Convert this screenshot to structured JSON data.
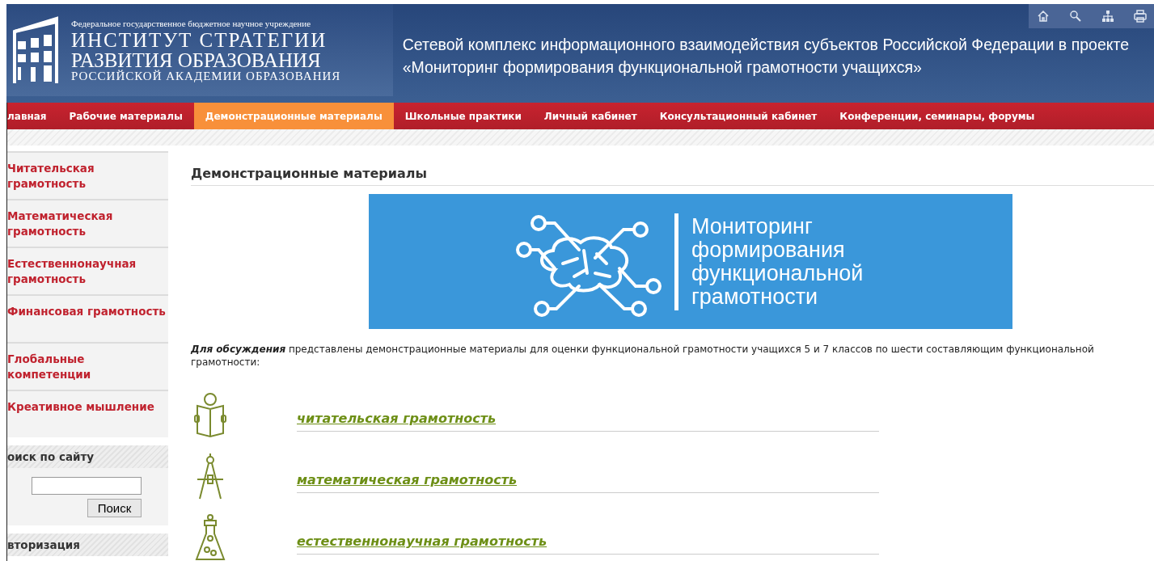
{
  "header": {
    "org_line": "Федеральное государственное бюджетное научное учреждение",
    "logo_lines": [
      "ИНСТИТУТ СТРАТЕГИИ",
      "РАЗВИТИЯ ОБРАЗОВАНИЯ",
      "РОССИЙСКОЙ АКАДЕМИИ ОБРАЗОВАНИЯ"
    ],
    "site_title": "Сетевой комплекс информационного взаимодействия субъектов Российской Федерации в проекте «Мониторинг формирования функциональной грамотности учащихся»"
  },
  "nav": [
    {
      "label": "лавная",
      "selected": false
    },
    {
      "label": "Рабочие материалы",
      "selected": false
    },
    {
      "label": "Демонстрационные материалы",
      "selected": true
    },
    {
      "label": "Школьные практики",
      "selected": false
    },
    {
      "label": "Личный кабинет",
      "selected": false
    },
    {
      "label": "Консультационный кабинет",
      "selected": false
    },
    {
      "label": "Конференции, семинары, форумы",
      "selected": false
    }
  ],
  "sidebar": {
    "items": [
      "Читательская грамотность",
      "Математическая грамотность",
      "Естественнонаучная грамотность",
      "Финансовая грамотность",
      "Глобальные компетенции",
      "Креативное мышление"
    ],
    "search": {
      "title": "оиск по сайту",
      "button": "Поиск"
    },
    "auth_title": "вторизация"
  },
  "content": {
    "heading": "Демонстрационные материалы",
    "banner": {
      "lines": [
        "Мониторинг",
        "формирования",
        "функциональной",
        "грамотности"
      ]
    },
    "intro": "**Для обсуждения** представлены демонстрационные материалы для оценки функциональной грамотности учащихся 5 и 7 классов по шести составляющим функциональной грамотности:",
    "categories": [
      {
        "kind": "reading",
        "label": "читательская грамотность"
      },
      {
        "kind": "math",
        "label": "математическая грамотность"
      },
      {
        "kind": "science",
        "label": "естественнонаучная грамотность"
      }
    ]
  }
}
